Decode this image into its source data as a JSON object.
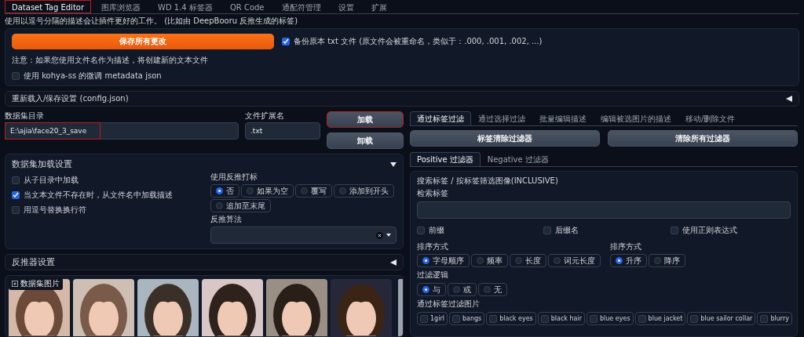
{
  "top_tabs": [
    {
      "label": "Dataset Tag Editor",
      "selected": true,
      "highlighted": true
    },
    {
      "label": "图库浏览器",
      "selected": false,
      "highlighted": false
    },
    {
      "label": "WD 1.4 标签器",
      "selected": false,
      "highlighted": false
    },
    {
      "label": "QR Code",
      "selected": false,
      "highlighted": false
    },
    {
      "label": "通配符管理",
      "selected": false,
      "highlighted": false
    },
    {
      "label": "设置",
      "selected": false,
      "highlighted": false
    },
    {
      "label": "扩展",
      "selected": false,
      "highlighted": false
    }
  ],
  "intro": "使用以逗号分隔的描述会让插件更好的工作。 (比如由 DeepBooru 反推生成的标签)",
  "save_button": "保存所有更改",
  "backup_checkbox": {
    "label": "备份原本 txt 文件 (原文件会被重命名，类似于：.000, .001, .002, ...)",
    "checked": true
  },
  "note": "注意：如果您使用文件名作为描述，将创建新的文本文件",
  "kohya_checkbox": {
    "label": "使用 kohya-ss 的微调 metadata json",
    "checked": false
  },
  "config_section": {
    "title": "重新载入/保存设置 (config.json)",
    "expanded": false
  },
  "dataset_dir": {
    "label": "数据集目录",
    "value": "E:\\ajia\\face20_3_save",
    "highlighted": true
  },
  "file_ext": {
    "label": "文件扩展名",
    "value": ".txt"
  },
  "load_button": {
    "label": "加载",
    "highlighted": true
  },
  "unload_button": {
    "label": "卸载"
  },
  "load_settings": {
    "title": "数据集加载设置",
    "expanded": true,
    "checkboxes": [
      {
        "label": "从子目录中加载",
        "checked": false
      },
      {
        "label": "当文本文件不存在时，从文件名中加载描述",
        "checked": true
      },
      {
        "label": "用逗号替换换行符",
        "checked": false
      }
    ],
    "interrogate": {
      "label": "使用反推打标",
      "options": [
        {
          "label": "否",
          "selected": true
        },
        {
          "label": "如果为空",
          "selected": false
        },
        {
          "label": "覆写",
          "selected": false
        },
        {
          "label": "添加到开头",
          "selected": false
        },
        {
          "label": "追加至末尾",
          "selected": false
        }
      ]
    },
    "algorithm": {
      "label": "反推算法"
    }
  },
  "interrogator_section": {
    "title": "反推器设置",
    "expanded": false
  },
  "gallery": {
    "label": "数据集图片"
  },
  "filter_tabs": [
    {
      "label": "通过标签过滤",
      "selected": true
    },
    {
      "label": "通过选择过滤",
      "selected": false
    },
    {
      "label": "批量编辑描述",
      "selected": false
    },
    {
      "label": "编辑被选图片的描述",
      "selected": false
    },
    {
      "label": "移动/删除文件",
      "selected": false
    }
  ],
  "clear_buttons": [
    "标签清除过滤器",
    "清除所有过滤器"
  ],
  "polarity_tabs": [
    {
      "label": "Positive 过滤器",
      "selected": true
    },
    {
      "label": "Negative 过滤器",
      "selected": false
    }
  ],
  "filter_panel": {
    "title": "搜索标签 / 按标签筛选图像(INCLUSIVE)",
    "search_label": "检索标签",
    "options": [
      {
        "label": "前缀",
        "checked": false
      },
      {
        "label": "后缀名",
        "checked": false
      },
      {
        "label": "使用正则表达式",
        "checked": false
      }
    ],
    "sort_by": {
      "label": "排序方式",
      "options": [
        {
          "label": "字母顺序",
          "selected": true
        },
        {
          "label": "频率",
          "selected": false
        },
        {
          "label": "长度",
          "selected": false
        },
        {
          "label": "词元长度",
          "selected": false
        }
      ]
    },
    "sort_order": {
      "label": "排序方式",
      "options": [
        {
          "label": "升序",
          "selected": true
        },
        {
          "label": "降序",
          "selected": false
        }
      ]
    },
    "logic": {
      "label": "过滤逻辑",
      "options": [
        {
          "label": "与",
          "selected": true
        },
        {
          "label": "或",
          "selected": false
        },
        {
          "label": "无",
          "selected": false
        }
      ]
    },
    "tags_label": "通过标签过滤图片",
    "tags": [
      {
        "label": "1girl",
        "checked": false
      },
      {
        "label": "bangs",
        "checked": false
      },
      {
        "label": "black eyes",
        "checked": false
      },
      {
        "label": "black hair",
        "checked": false
      },
      {
        "label": "blue eyes",
        "checked": false
      },
      {
        "label": "blue jacket",
        "checked": false
      },
      {
        "label": "blue sailor collar",
        "checked": false
      },
      {
        "label": "blurry",
        "checked": false
      }
    ]
  }
}
